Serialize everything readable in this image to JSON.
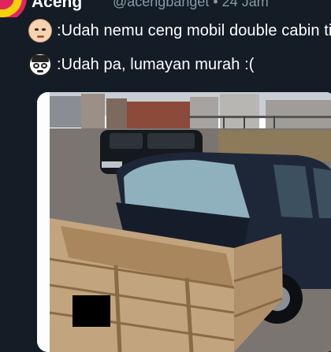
{
  "tweet": {
    "author_name": "Aceng",
    "author_meta": "@acengbanget • 24 Jam",
    "avatar_icon": "avatar-circle-icon"
  },
  "messages": [
    {
      "icon": "boss-baby-emoji-icon",
      "text": ":Udah nemu ceng mobil double cabin ti"
    },
    {
      "icon": "nerd-face-emoji-icon",
      "text": ":Udah pa, lumayan murah :("
    }
  ],
  "photo": {
    "icon": "car-with-wooden-crate-photo"
  },
  "colors": {
    "background": "#141d26",
    "meta_text": "#8899a6",
    "text": "#ffffff"
  }
}
